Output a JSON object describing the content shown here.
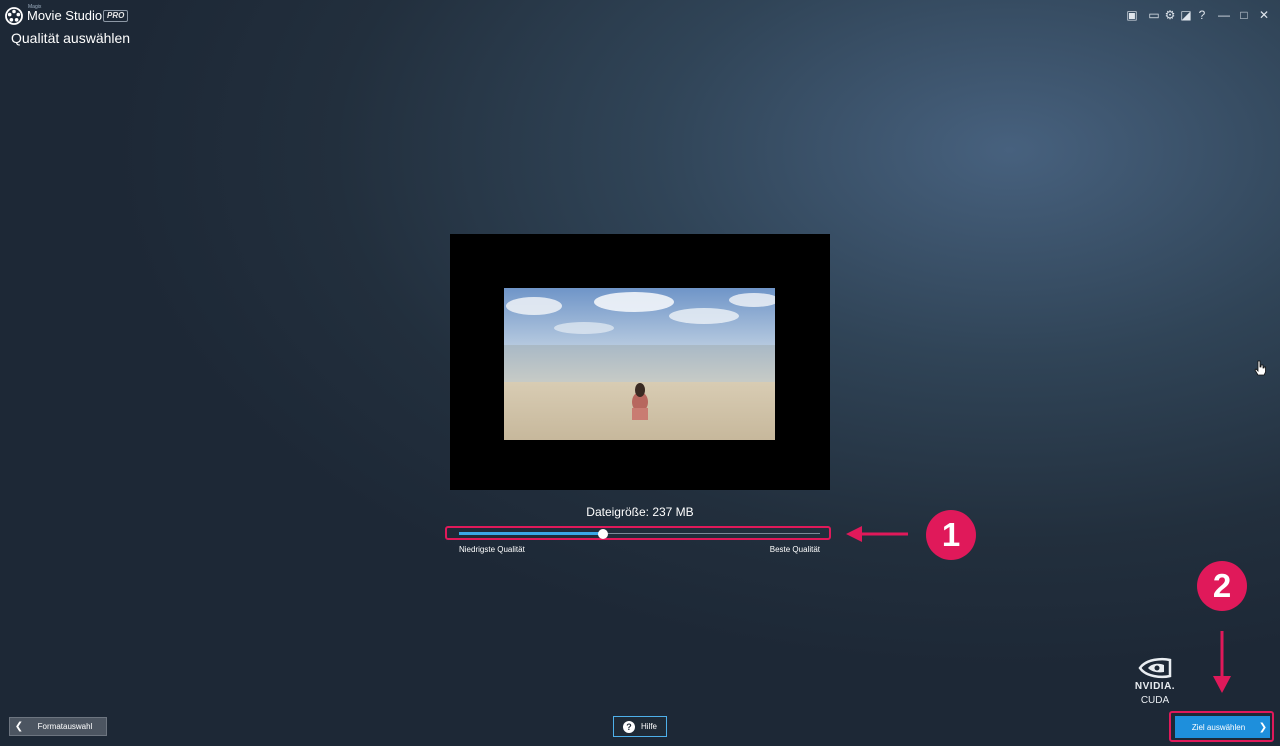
{
  "window": {
    "brand_small": "Magix",
    "app_name": "Movie Studio",
    "edition": "PRO",
    "controls": [
      {
        "name": "chat-icon",
        "glyph": "▣"
      },
      {
        "name": "monitor-icon",
        "glyph": "▭"
      },
      {
        "name": "gear-icon",
        "glyph": "⚙"
      },
      {
        "name": "sync-icon",
        "glyph": "◪"
      },
      {
        "name": "help-icon",
        "glyph": "?"
      },
      {
        "name": "minimize-icon",
        "glyph": "—"
      },
      {
        "name": "maximize-icon",
        "glyph": "□"
      },
      {
        "name": "close-icon",
        "glyph": "✕"
      }
    ]
  },
  "page": {
    "title": "Qualität auswählen"
  },
  "quality": {
    "filesize_text": "Dateigröße: 237 MB",
    "value_fraction": 0.4,
    "low_label": "Niedrigste Qualität",
    "high_label": "Beste Qualität"
  },
  "annotations": {
    "marker1": "1",
    "marker2": "2",
    "color": "#e0195a"
  },
  "nvidia": {
    "name": "NVIDIA.",
    "tech": "CUDA"
  },
  "footer": {
    "back_label": "Formatauswahl",
    "help_label": "Hilfe",
    "next_label": "Ziel auswählen"
  }
}
